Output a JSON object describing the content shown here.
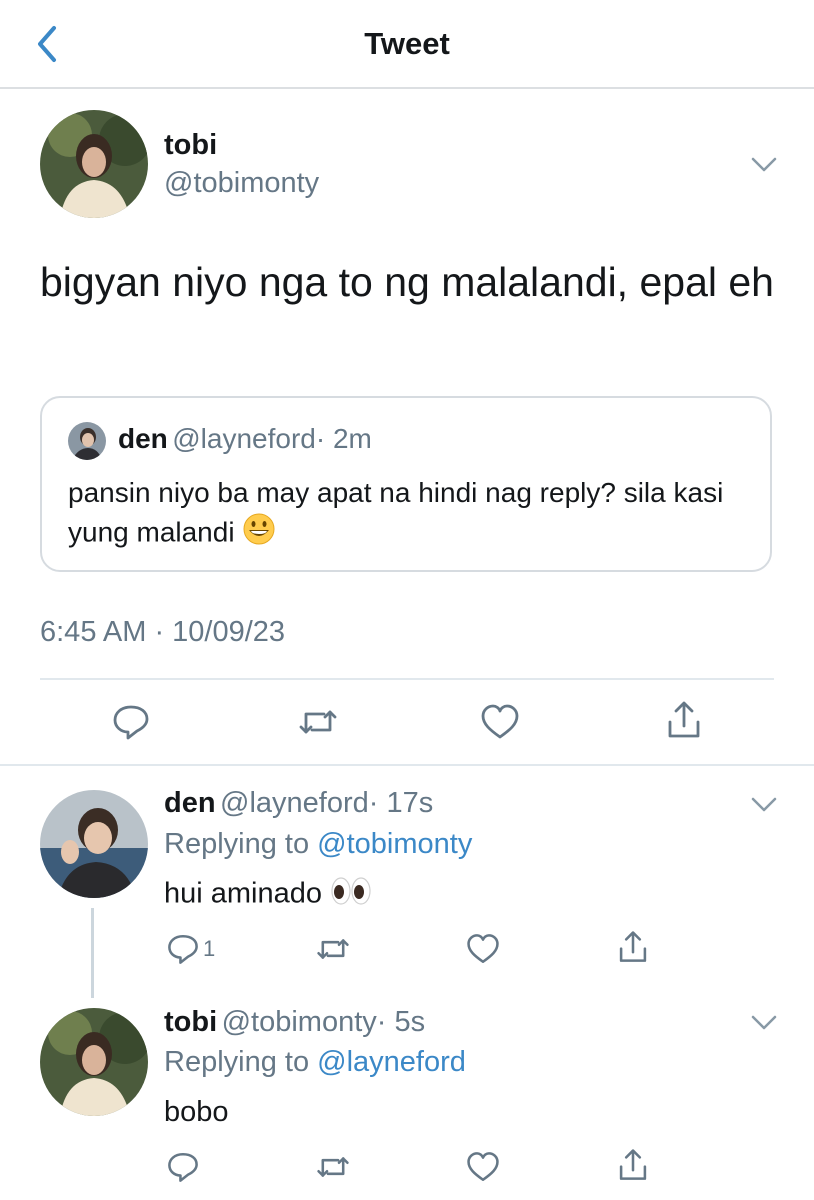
{
  "header": {
    "title": "Tweet",
    "back_icon": "chevron-left-icon"
  },
  "main_tweet": {
    "name": "tobi",
    "handle": "@tobimonty",
    "text": "bigyan niyo nga to ng malalandi, epal eh",
    "quote": {
      "name": "den",
      "handle": "@layneford",
      "time": "· 2m",
      "text": "pansin niyo ba may apat na hindi nag reply? sila kasi yung malandi",
      "emoji": "grinning-face-emoji"
    },
    "timestamp": "6:45 AM · 10/09/23",
    "actions": [
      "reply-icon",
      "retweet-icon",
      "like-icon",
      "share-icon"
    ]
  },
  "replies": [
    {
      "name": "den",
      "handle": "@layneford",
      "time": "· 17s",
      "replying_prefix": "Replying to",
      "replying_to": "@tobimonty",
      "text": "hui aminado",
      "emoji": "eyes-emoji",
      "reply_count": "1"
    },
    {
      "name": "tobi",
      "handle": "@tobimonty",
      "time": "· 5s",
      "replying_prefix": "Replying to",
      "replying_to": "@layneford",
      "text": "bobo"
    }
  ],
  "colors": {
    "accent": "#3b88c7",
    "muted": "#657786",
    "border": "#d6dbe0"
  }
}
